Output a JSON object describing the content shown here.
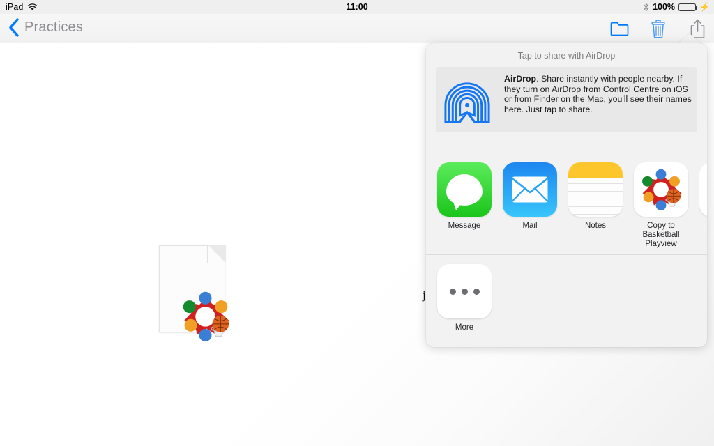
{
  "status_bar": {
    "device_name": "iPad",
    "wifi_icon": "wifi-icon",
    "time": "11:00",
    "bluetooth_icon": "bluetooth-icon",
    "battery_percent": "100%",
    "battery_charging": true,
    "charging_icon": "lightning-bolt-icon"
  },
  "nav_bar": {
    "back_icon": "chevron-left-icon",
    "back_label": "Practices",
    "actions": [
      {
        "name": "folder-icon",
        "label": "Move to folder"
      },
      {
        "name": "trash-icon",
        "label": "Delete"
      },
      {
        "name": "share-icon",
        "label": "Share"
      }
    ]
  },
  "canvas": {
    "document": {
      "name": "basketball-playview-document",
      "thumbnail_icon": "basketball-playview-logo"
    },
    "stray_text": "j"
  },
  "share_sheet": {
    "airdrop": {
      "title": "Tap to share with AirDrop",
      "logo_icon": "airdrop-icon",
      "description_bold": "AirDrop",
      "description": ". Share instantly with people nearby. If they turn on AirDrop from Control Centre on iOS or from Finder on the Mac, you'll see their names here. Just tap to share."
    },
    "apps_row": [
      {
        "label": "Message",
        "icon": "messages-icon"
      },
      {
        "label": "Mail",
        "icon": "mail-icon"
      },
      {
        "label": "Notes",
        "icon": "notes-icon"
      },
      {
        "label": "Copy to Basketball Playview",
        "icon": "basketball-playview-logo"
      },
      {
        "label": "",
        "icon": "partial-app-icon"
      }
    ],
    "actions_row": [
      {
        "label": "More",
        "icon": "more-ellipsis-icon"
      }
    ]
  },
  "colors": {
    "tint_blue": "#007aff",
    "battery_green": "#4cd764",
    "notes_yellow": "#fdc72c",
    "message_green": "#1bc51b",
    "mail_blue": "#1d86f0",
    "popover_bg": "#f2f2f2"
  }
}
